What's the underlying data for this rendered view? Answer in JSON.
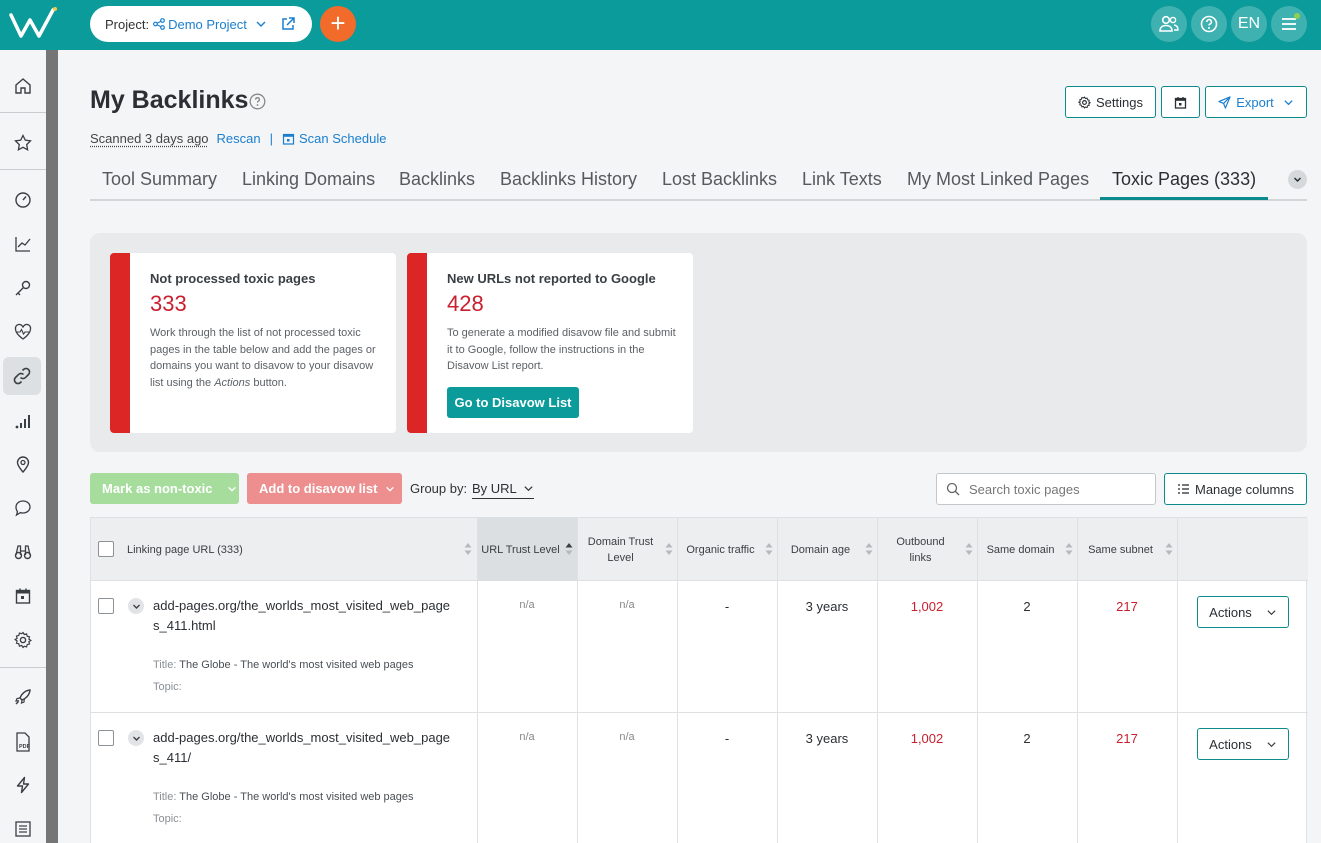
{
  "header": {
    "project_label": "Project:",
    "project_name": "Demo Project",
    "lang": "EN"
  },
  "page": {
    "title": "My Backlinks",
    "scanned": "Scanned 3 days ago",
    "rescan": "Rescan",
    "scan_schedule": "Scan Schedule",
    "settings": "Settings",
    "export": "Export"
  },
  "tabs": [
    {
      "label": "Tool Summary"
    },
    {
      "label": "Linking Domains"
    },
    {
      "label": "Backlinks"
    },
    {
      "label": "Backlinks History"
    },
    {
      "label": "Lost Backlinks"
    },
    {
      "label": "Link Texts"
    },
    {
      "label": "My Most Linked Pages"
    },
    {
      "label": "Toxic Pages (333)"
    }
  ],
  "cards": [
    {
      "title": "Not processed toxic pages",
      "value": "333",
      "desc_1": "Work through the list of not processed toxic pages in the table below and add the pages or domains you want to disavow to your disavow list using the ",
      "desc_em": "Actions",
      "desc_2": " button."
    },
    {
      "title": "New URLs not reported to Google",
      "value": "428",
      "desc": "To generate a modified disavow file and submit it to Google, follow the instructions in the Disavow List report.",
      "button": "Go to Disavow List"
    }
  ],
  "toolbar": {
    "mark_non_toxic": "Mark as non-toxic",
    "add_disavow": "Add to disavow list",
    "group_by_label": "Group by:",
    "group_by_value": "By URL",
    "search_placeholder": "Search toxic pages",
    "manage_columns": "Manage columns"
  },
  "table": {
    "columns": {
      "url": "Linking page URL (333)",
      "url_trust": "URL Trust Level",
      "domain_trust": "Domain Trust Level",
      "organic": "Organic traffic",
      "domain_age": "Domain age",
      "outbound": "Outbound links",
      "same_domain": "Same domain",
      "same_subnet": "Same subnet"
    },
    "title_label": "Title:",
    "topic_label": "Topic:",
    "actions_label": "Actions",
    "rows": [
      {
        "url": "add-pages.org/the_worlds_most_visited_web_pages_411.html",
        "title": "The Globe - The world's most visited web pages",
        "url_trust": "n/a",
        "domain_trust": "n/a",
        "organic": "-",
        "domain_age": "3 years",
        "outbound": "1,002",
        "same_domain": "2",
        "same_subnet": "217"
      },
      {
        "url": "add-pages.org/the_worlds_most_visited_web_pages_411/",
        "title": "The Globe - The world's most visited web pages",
        "url_trust": "n/a",
        "domain_trust": "n/a",
        "organic": "-",
        "domain_age": "3 years",
        "outbound": "1,002",
        "same_domain": "2",
        "same_subnet": "217"
      }
    ]
  },
  "colors": {
    "teal": "#0b9b9b",
    "orange": "#f26b2a",
    "red": "#dc2626",
    "link": "#1a7fcf"
  }
}
